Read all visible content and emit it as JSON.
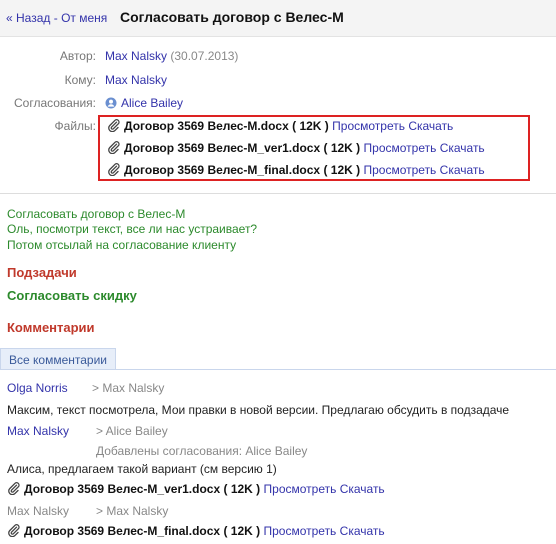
{
  "nav": {
    "back_label": "« Назад",
    "separator": "-",
    "from_me_label": "От меня"
  },
  "page_title": "Согласовать договор с Велес-М",
  "details": {
    "author_label": "Автор:",
    "author_name": "Max Nalsky",
    "author_date": "(30.07.2013)",
    "to_label": "Кому:",
    "to_name": "Max Nalsky",
    "approvals_label": "Согласования:",
    "approver_name": "Alice Bailey",
    "files_label": "Файлы:",
    "files": [
      {
        "name": "Договор 3569 Велес-M.docx",
        "size": "( 12K )",
        "view": "Просмотреть",
        "download": "Скачать"
      },
      {
        "name": "Договор 3569 Велес-M_ver1.docx",
        "size": "( 12K )",
        "view": "Просмотреть",
        "download": "Скачать"
      },
      {
        "name": "Договор 3569 Велес-M_final.docx",
        "size": "( 12K )",
        "view": "Просмотреть",
        "download": "Скачать"
      }
    ]
  },
  "description": {
    "line1": "Согласовать договор с Велес-М",
    "line2": "Оль, посмотри текст, все ли нас устраивает?",
    "line3": "Потом отсылай на согласование клиенту"
  },
  "subtasks": {
    "heading": "Подзадачи",
    "item": "Согласовать скидку"
  },
  "comments": {
    "heading": "Комментарии",
    "tab_label": "Все комментарии",
    "items": [
      {
        "author": "Olga Norris",
        "to": "> Max Nalsky",
        "text": "Максим, текст посмотрела, Мои правки в новой версии. Предлагаю обсудить в подзадаче"
      },
      {
        "author": "Max Nalsky",
        "to": "> Alice Bailey",
        "added": "Добавлены согласования: Alice Bailey",
        "text": "Алиса, предлагаем такой вариант (см версию 1)",
        "file": {
          "name": "Договор 3569 Велес-M_ver1.docx",
          "size": "( 12K )",
          "view": "Просмотреть",
          "download": "Скачать"
        }
      },
      {
        "author": "Max Nalsky",
        "to": "> Max Nalsky",
        "file": {
          "name": "Договор 3569 Велес-M_final.docx",
          "size": "( 12K )",
          "view": "Просмотреть",
          "download": "Скачать"
        }
      }
    ]
  },
  "colors": {
    "link": "#3333aa",
    "green": "#2c8a2c",
    "red": "#c0392b",
    "highlight_box": "#dd2222"
  },
  "icons": {
    "file": "paperclip-icon",
    "approver": "user-avatar-icon"
  }
}
